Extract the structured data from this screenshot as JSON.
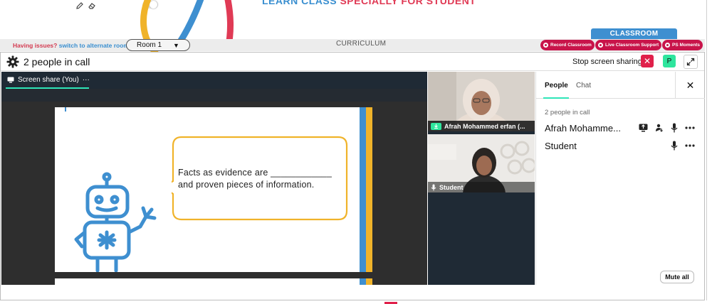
{
  "banner": {
    "text_a": "LEARN CLASS ",
    "text_b": "SPECIALLY FOR STUDENT"
  },
  "curriculum_bar": {
    "issues_label": "Having issues?",
    "alternate_link": "switch to alternate room",
    "room_value": "Room 1",
    "curriculum_label": "CURRICULUM",
    "classroom_tab": "CLASSROOM",
    "pills": [
      {
        "label": "Record Classroom"
      },
      {
        "label": "Live Classroom Support"
      },
      {
        "label": "PS Moments"
      }
    ]
  },
  "call": {
    "people_count": "2 people in call",
    "stop_sharing_label": "Stop screen sharing",
    "stop_button": "✕",
    "participant_button": "P"
  },
  "share": {
    "tab_label": "Screen share (You)",
    "tab_menu": "···",
    "slide_text": "Facts as evidence are ____________ and proven pieces of information."
  },
  "tiles": [
    {
      "name": "Afrah Mohammed erfan (..."
    },
    {
      "name": "Student"
    }
  ],
  "panel": {
    "tab_people": "People",
    "tab_chat": "Chat",
    "close": "✕",
    "in_call_label": "2 people in call",
    "people": [
      {
        "name": "Afrah Mohamme..."
      },
      {
        "name": "Student"
      }
    ],
    "mute_all": "Mute all"
  },
  "colors": {
    "accent_blue": "#3e8fd0",
    "accent_red": "#c8144a",
    "accent_green": "#2ee59d",
    "slide_yellow": "#f0b32a"
  }
}
